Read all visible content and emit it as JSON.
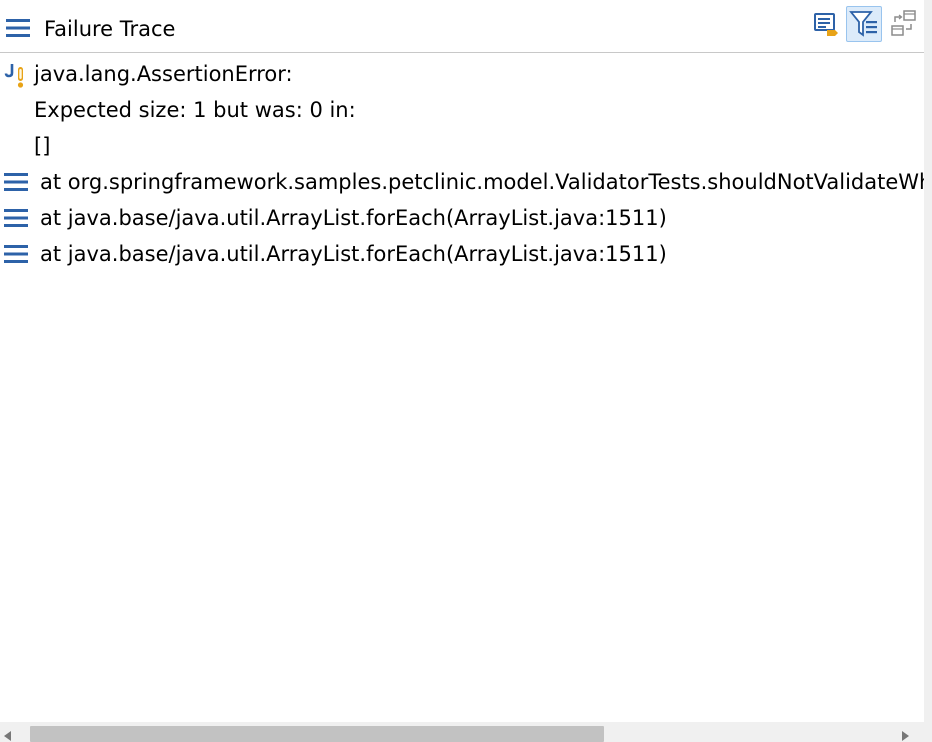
{
  "header": {
    "title": "Failure Trace",
    "title_icon": "stack-lines-icon",
    "toolbar": [
      {
        "name": "compare-result-icon",
        "active": false
      },
      {
        "name": "filter-stack-trace-icon",
        "active": true
      },
      {
        "name": "show-history-icon",
        "active": false
      }
    ]
  },
  "trace": {
    "message_lines": [
      "java.lang.AssertionError:",
      "Expected size: 1 but was: 0 in:",
      "[]"
    ],
    "frames": [
      "at org.springframework.samples.petclinic.model.ValidatorTests.shouldNotValidateWh",
      "at java.base/java.util.ArrayList.forEach(ArrayList.java:1511)",
      "at java.base/java.util.ArrayList.forEach(ArrayList.java:1511)"
    ]
  },
  "scrollbar": {
    "thumb_fraction": 0.62
  },
  "colors": {
    "accent": "#2b6cb0",
    "icon_blue": "#2d62a8",
    "warning_orange": "#e8a317",
    "active_button_bg": "#dcebfa"
  }
}
